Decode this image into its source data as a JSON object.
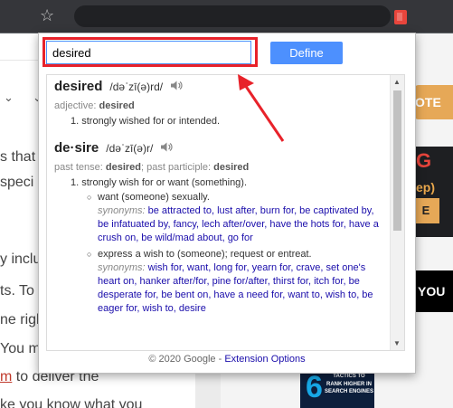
{
  "popup": {
    "search_value": "desired",
    "define_label": "Define",
    "entries": [
      {
        "word": "desired",
        "pronunciation": "/dəˈzī(ə)rd/",
        "grammar_prefix": "adjective: ",
        "grammar_term": "desired",
        "definitions": [
          "1. strongly wished for or intended."
        ]
      },
      {
        "word": "de·sire",
        "pronunciation": "/dəˈzī(ə)r/",
        "past_tense_label": "past tense: ",
        "past_tense": "desired",
        "past_participle_label": "; past participle: ",
        "past_participle": "desired",
        "definitions": [
          "1. strongly wish for or want (something)."
        ],
        "senses": [
          {
            "text": "want (someone) sexually.",
            "synonyms_label": "synonyms:",
            "synonyms": "be attracted to, lust after, burn for, be captivated by, be infatuated by, fancy, lech after/over, have the hots for, have a crush on, be wild/mad about, go for"
          },
          {
            "text": "express a wish to (someone); request or entreat.",
            "synonyms_label": "synonyms:",
            "synonyms": "wish for, want, long for, yearn for, crave, set one's heart on, hanker after/for, pine for/after, thirst for, itch for, be desperate for, be bent on, have a need for, want to, wish to, be eager for, wish to, desire"
          }
        ]
      }
    ],
    "footer_text": "© 2020 Google - ",
    "footer_link": "Extension Options"
  },
  "background": {
    "fragments": [
      "s that",
      "speci",
      "y inclu",
      "ts. To",
      "ne righ",
      "You m",
      "m",
      " to deliver the",
      "ke you know what you"
    ],
    "promo_button": "OTE",
    "banner_g": "G",
    "banner_ep": "ep)",
    "banner_e": "E",
    "you_banner": "YOU",
    "book_number": "6",
    "book_line1": "TACTICS TO",
    "book_line2": "RANK HIGHER IN",
    "book_line3": "SEARCH ENGINES"
  },
  "icons": {
    "star": "star-icon",
    "speaker": "speaker-icon",
    "extension": "dictionary-extension-icon"
  },
  "colors": {
    "highlight": "#e8222a",
    "define_button": "#4d90fe",
    "synonym_link": "#1a0dab",
    "chrome_dark": "#35363a"
  }
}
